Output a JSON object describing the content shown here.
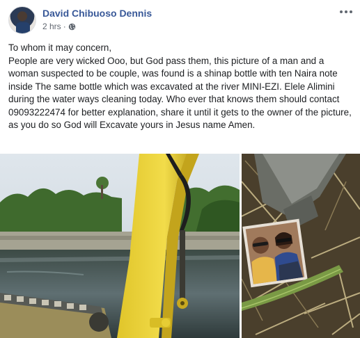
{
  "post": {
    "author": "David Chibuoso Dennis",
    "time": "2 hrs",
    "dot": "·",
    "body": [
      "To whom it may concern,",
      "People are very wicked Ooo, but God pass them, this picture of a man and a woman suspected to be couple, was found is a shinap bottle with ten Naira note inside The same bottle which was excavated at the river MINI-EZI. Elele Alimini during the water ways cleaning today. Who ever that knows them should contact 09093222474 for better explanation, share it until it gets to the owner of the picture, as you do so God will Excavate yours in Jesus name Amen."
    ]
  },
  "icons": {
    "avatar": "profile-avatar",
    "privacy": "globe-icon",
    "menu": "more-options-icon"
  },
  "colors": {
    "author": "#385898",
    "meta": "#616770",
    "text": "#1c1e21"
  }
}
